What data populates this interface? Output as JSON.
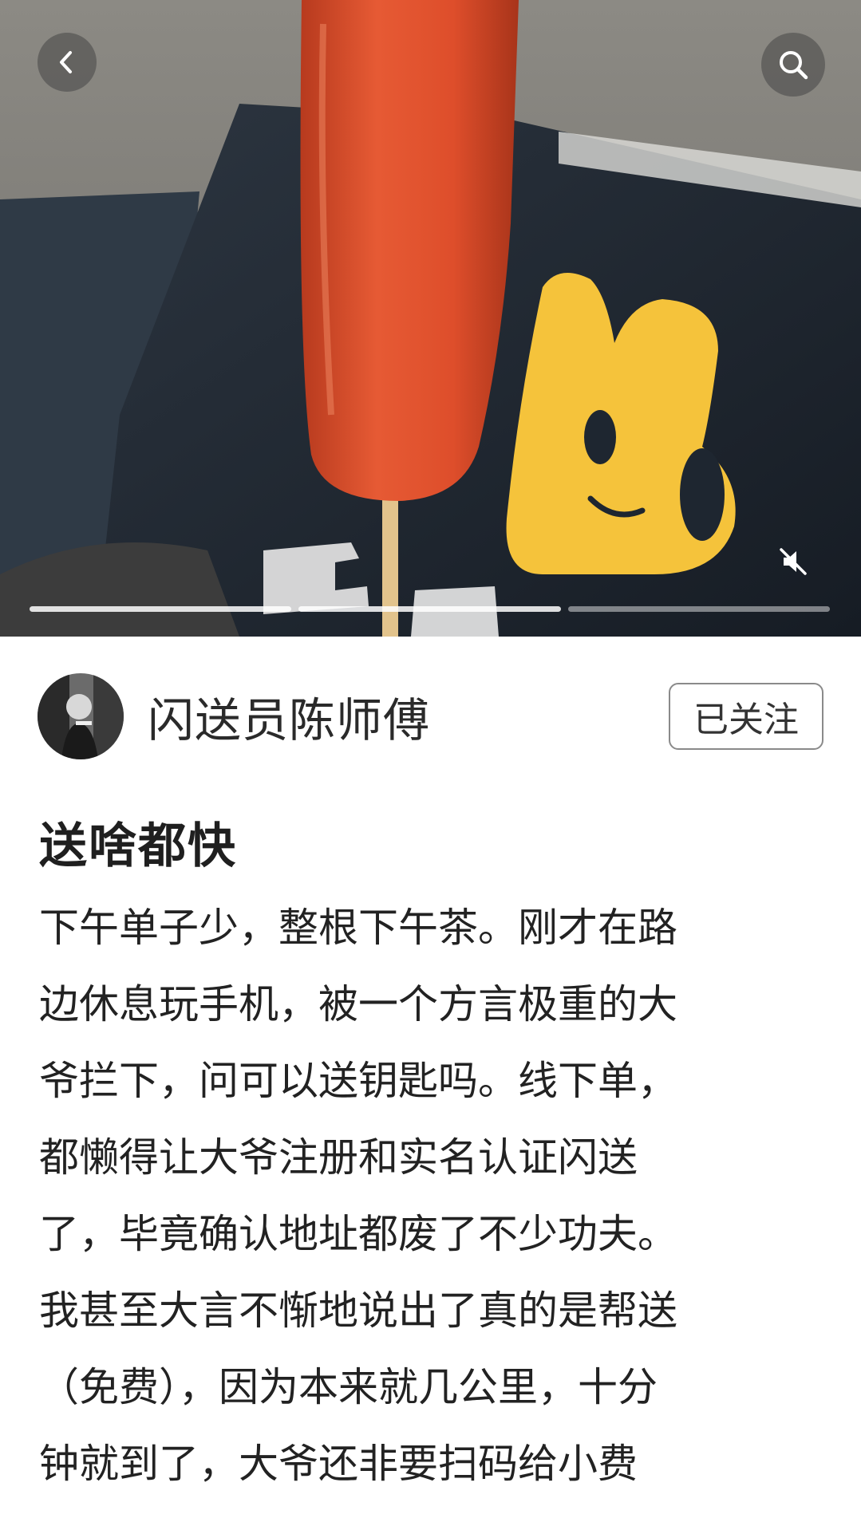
{
  "media": {
    "progress_segments": 3,
    "active_segment": 1
  },
  "icons": {
    "back": "chevron-left-icon",
    "search": "search-icon",
    "mute": "speaker-muted-icon"
  },
  "author": {
    "name": "闪送员陈师傅",
    "follow_label": "已关注"
  },
  "post": {
    "title": "送啥都快",
    "lines": [
      "下午单子少，整根下午茶。刚才在路",
      "边休息玩手机，被一个方言极重的大",
      "爷拦下，问可以送钥匙吗。线下单，",
      "都懒得让大爷注册和实名认证闪送",
      "了，毕竟确认地址都废了不少功夫。",
      "我甚至大言不惭地说出了真的是帮送",
      "（免费），因为本来就几公里，十分",
      "钟就到了，大爷还非要扫码给小费"
    ]
  },
  "colors": {
    "sausage": "#e0502f",
    "logo_yellow": "#f5c33b",
    "bag_dark": "#1e2630"
  }
}
